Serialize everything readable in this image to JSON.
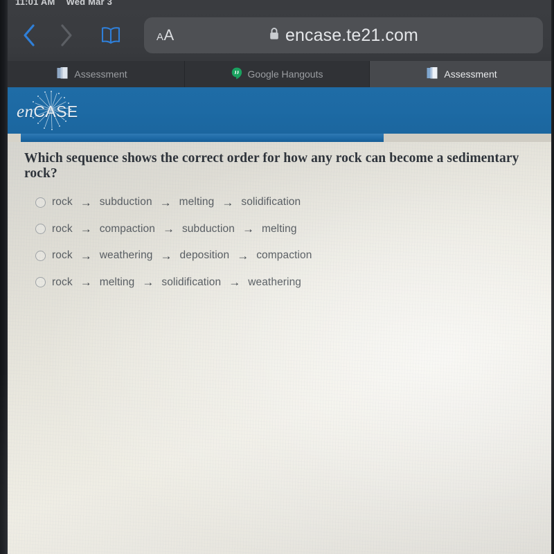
{
  "status_bar": {
    "time": "11:01 AM",
    "date": "Wed Mar 3"
  },
  "browser": {
    "back_icon": "chevron-left-icon",
    "forward_icon": "chevron-right-icon",
    "bookmarks_icon": "book-icon",
    "text_size_small": "A",
    "text_size_large": "A",
    "lock_icon": "lock-icon",
    "url": "encase.te21.com",
    "tabs": [
      {
        "label": "Assessment",
        "icon": "document-icon",
        "active": false
      },
      {
        "label": "Google Hangouts",
        "icon": "hangouts-icon",
        "active": false
      },
      {
        "label": "Assessment",
        "icon": "document-icon",
        "active": true
      }
    ]
  },
  "app": {
    "logo_prefix": "en",
    "logo_suffix": "CASE",
    "logo_icon": "starburst-icon",
    "header_color": "#1d6aa4",
    "progress": {
      "percent": 68,
      "fill_color": "#1c68a4",
      "track_color": "#cfccc3"
    }
  },
  "quiz": {
    "question": "Which sequence shows the correct order for how any rock can become a sedimentary rock?",
    "arrow_glyph": "→",
    "options": [
      {
        "selected": false,
        "steps": [
          "rock",
          "subduction",
          "melting",
          "solidification"
        ]
      },
      {
        "selected": false,
        "steps": [
          "rock",
          "compaction",
          "subduction",
          "melting"
        ]
      },
      {
        "selected": false,
        "steps": [
          "rock",
          "weathering",
          "deposition",
          "compaction"
        ]
      },
      {
        "selected": false,
        "steps": [
          "rock",
          "melting",
          "solidification",
          "weathering"
        ]
      }
    ]
  }
}
